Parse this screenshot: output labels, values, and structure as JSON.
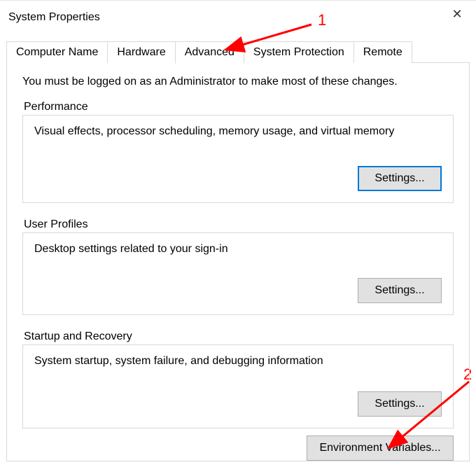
{
  "window": {
    "title": "System Properties"
  },
  "tabs": [
    {
      "label": "Computer Name"
    },
    {
      "label": "Hardware"
    },
    {
      "label": "Advanced"
    },
    {
      "label": "System Protection"
    },
    {
      "label": "Remote"
    }
  ],
  "notice": "You must be logged on as an Administrator to make most of these changes.",
  "performance": {
    "title": "Performance",
    "desc": "Visual effects, processor scheduling, memory usage, and virtual memory",
    "button": "Settings..."
  },
  "userprofiles": {
    "title": "User Profiles",
    "desc": "Desktop settings related to your sign-in",
    "button": "Settings..."
  },
  "startup": {
    "title": "Startup and Recovery",
    "desc": "System startup, system failure, and debugging information",
    "button": "Settings..."
  },
  "env_button": "Environment Variables...",
  "annotations": {
    "num1": "1",
    "num2": "2"
  }
}
